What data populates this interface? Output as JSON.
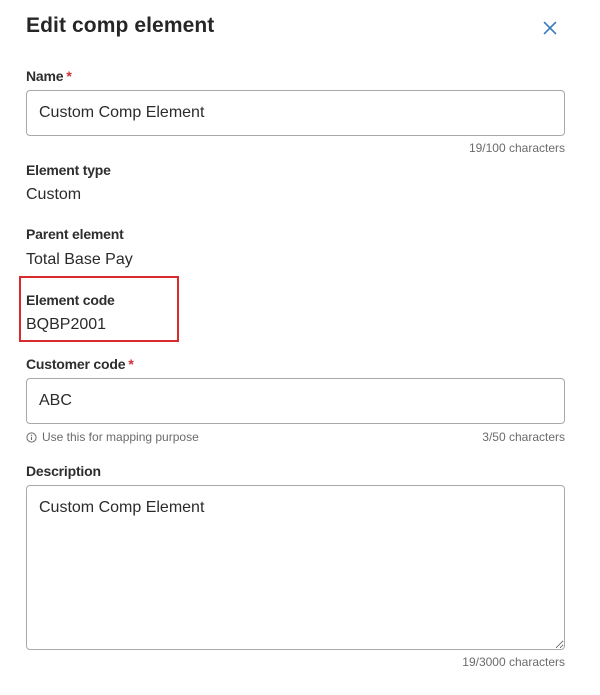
{
  "dialog": {
    "title": "Edit comp element",
    "close_icon": "close-icon"
  },
  "name": {
    "label": "Name",
    "required": "*",
    "value": "Custom Comp Element",
    "counter": "19/100 characters"
  },
  "element_type": {
    "label": "Element type",
    "value": "Custom"
  },
  "parent_element": {
    "label": "Parent element",
    "value": "Total Base Pay"
  },
  "element_code": {
    "label": "Element code",
    "value": "BQBP2001"
  },
  "customer_code": {
    "label": "Customer code",
    "required": "*",
    "value": "ABC",
    "hint": "Use this for mapping purpose",
    "hint_icon": "info-icon",
    "counter": "3/50 characters"
  },
  "description": {
    "label": "Description",
    "value": "Custom Comp Element",
    "counter": "19/3000 characters"
  },
  "colors": {
    "required": "#d32f2f",
    "highlight": "#d92b2b",
    "close": "#3b7dbf"
  }
}
